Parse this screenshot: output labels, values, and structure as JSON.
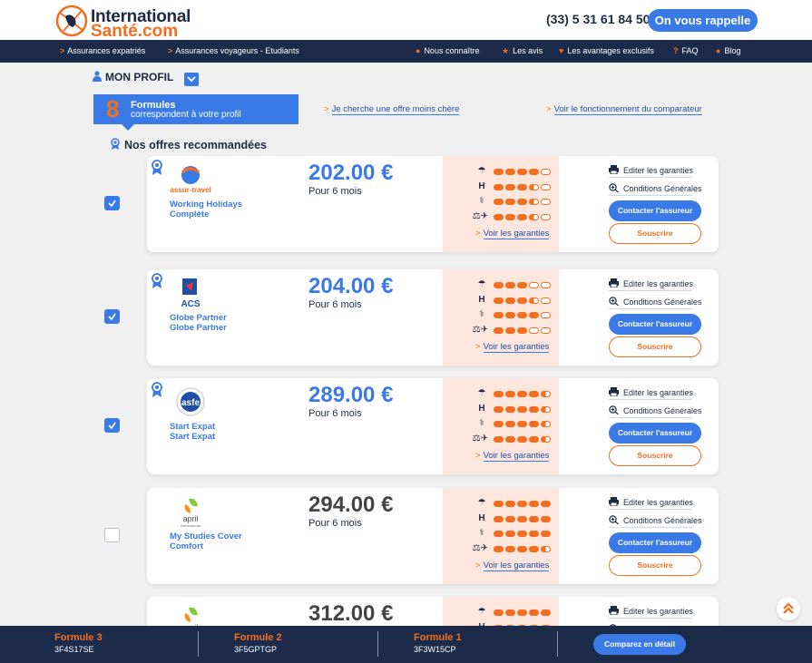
{
  "header": {
    "logo_line1": "International",
    "logo_line2": "Santé.com",
    "phone": "(33) 5 31 61 84 50",
    "callback_label": "On vous rappelle"
  },
  "nav": {
    "left_items": [
      "Assurances expatriés",
      "Assurances voyageurs - Etudiants"
    ],
    "right_items": [
      {
        "label": "Nous connaître",
        "icon": "group-icon"
      },
      {
        "label": "Les avis",
        "icon": "star-icon"
      },
      {
        "label": "Les avantages exclusifs",
        "icon": "heart-icon"
      },
      {
        "label": "FAQ",
        "icon": "question-icon"
      },
      {
        "label": "Blog",
        "icon": "speech-bubble-icon"
      }
    ]
  },
  "profile": {
    "label": "MON PROFIL"
  },
  "summary": {
    "count": "8",
    "title": "Formules",
    "subtitle": "correspondent à votre profil",
    "link_cheaper": "Je cherche une offre moins chère",
    "link_howto": "Voir le fonctionnement du comparateur"
  },
  "recommended_title": "Nos offres recommandées",
  "colors": {
    "accent": "#3a7ae6",
    "orange": "#f36f1f",
    "navy": "#1b2b49",
    "guarantee_bg": "#fde6dd"
  },
  "offers": [
    {
      "insurer": "assur-travel",
      "product_line1": "Working Holidays",
      "product_line2": "Complète",
      "price": "202.00 €",
      "duration": "Pour 6 mois",
      "checked": true,
      "recommended": true,
      "ratings": [
        4,
        3.5,
        3.5,
        3.5
      ]
    },
    {
      "insurer": "ACS",
      "product_line1": "Globe Partner",
      "product_line2": "Globe Partner",
      "price": "204.00 €",
      "duration": "Pour 6 mois",
      "checked": true,
      "recommended": true,
      "ratings": [
        3,
        3.5,
        4,
        3
      ]
    },
    {
      "insurer": "asfe",
      "product_line1": "Start Expat",
      "product_line2": "Start Expat",
      "price": "289.00 €",
      "duration": "Pour 6 mois",
      "checked": true,
      "recommended": true,
      "ratings": [
        4.5,
        4.5,
        4.5,
        4.5
      ]
    },
    {
      "insurer": "april International",
      "product_line1": "My Studies Cover",
      "product_line2": "Comfort",
      "price": "294.00 €",
      "duration": "Pour 6 mois",
      "checked": false,
      "recommended": false,
      "ratings": [
        5,
        5,
        5,
        4.5
      ]
    },
    {
      "insurer": "april",
      "product_line1": "",
      "product_line2": "",
      "price": "312.00 €",
      "duration": "",
      "checked": false,
      "recommended": false,
      "ratings": [
        5,
        5,
        5,
        5
      ]
    }
  ],
  "offer_actions": {
    "garanties_link": "Voir les garanties",
    "edit_label": "Editer les garanties",
    "conditions_label": "Conditions Générales",
    "contact_label": "Contacter l'assureur",
    "subscribe_label": "Souscrire"
  },
  "footer": {
    "formulas": [
      {
        "title": "Formule 3",
        "code": "3F4S17SE"
      },
      {
        "title": "Formule 2",
        "code": "3F5GPTGP"
      },
      {
        "title": "Formule 1",
        "code": "3F3W15CP"
      }
    ],
    "compare_label": "Comparez en détail"
  }
}
